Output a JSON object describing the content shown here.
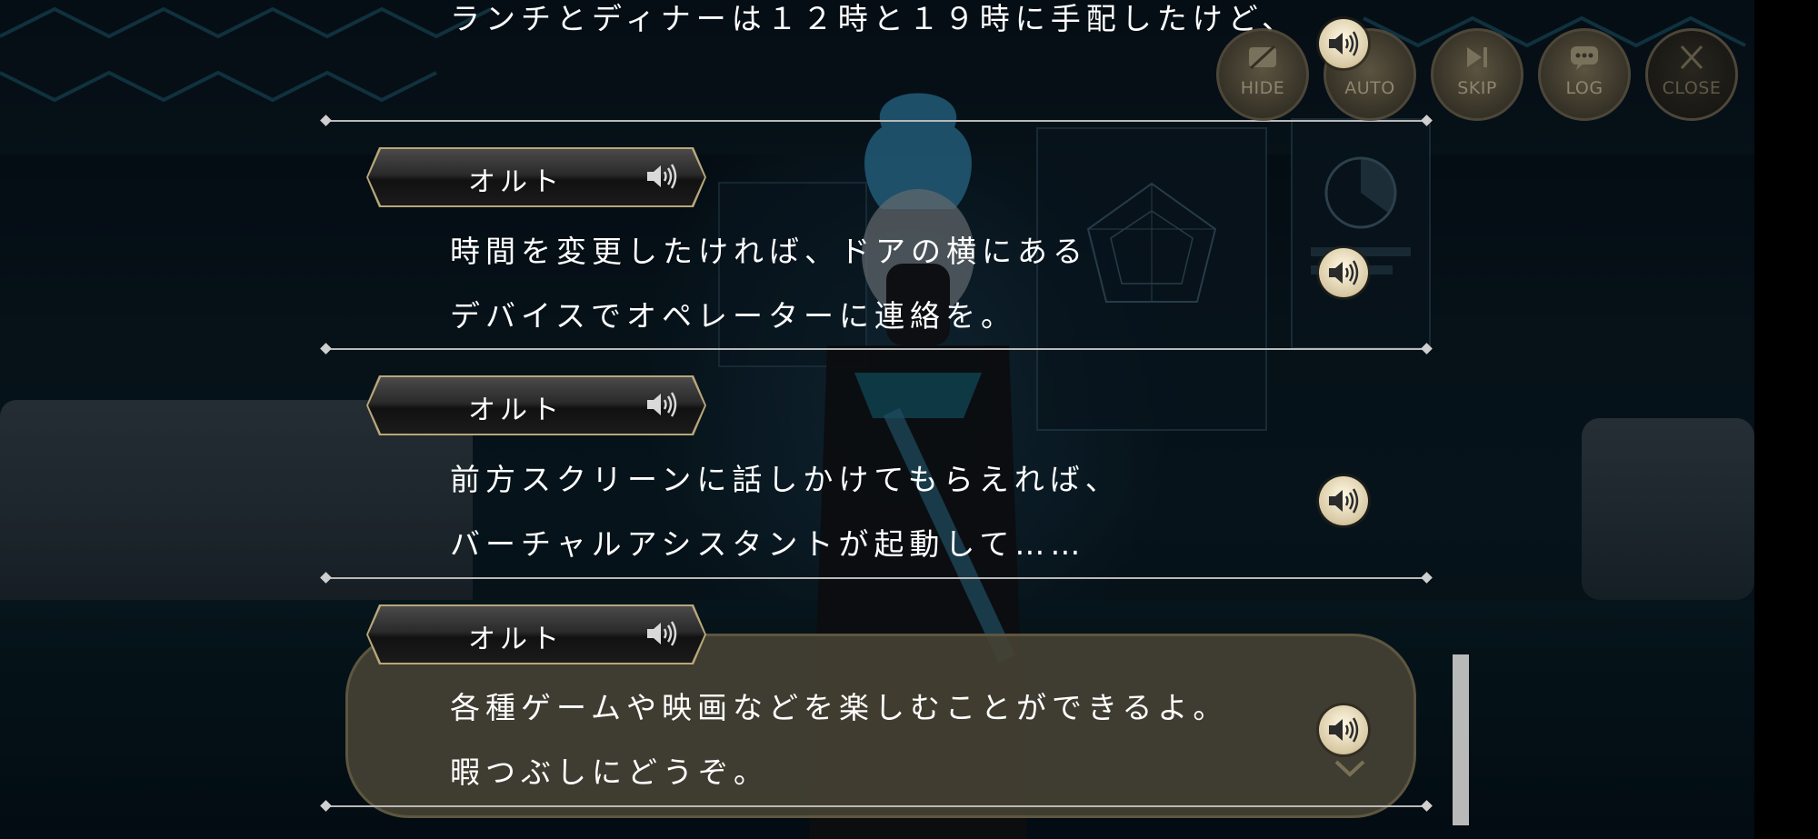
{
  "top_partial_line": "ランチとディナーは１２時と１９時に手配したけど、",
  "entries": [
    {
      "speaker": "オルト",
      "lines": [
        "時間を変更したければ、ドアの横にある",
        "デバイスでオペレーターに連絡を。"
      ]
    },
    {
      "speaker": "オルト",
      "lines": [
        "前方スクリーンに話しかけてもらえれば、",
        "バーチャルアシスタントが起動して……"
      ]
    },
    {
      "speaker": "オルト",
      "lines": [
        "各種ゲームや映画などを楽しむことができるよ。",
        "暇つぶしにどうぞ。"
      ]
    }
  ],
  "controls": {
    "hide": "HIDE",
    "auto": "AUTO",
    "skip": "SKIP",
    "log": "LOG",
    "close": "CLOSE"
  },
  "icons": {
    "voice": "speaker-icon",
    "scroll_more": "chevron-down-icon"
  }
}
